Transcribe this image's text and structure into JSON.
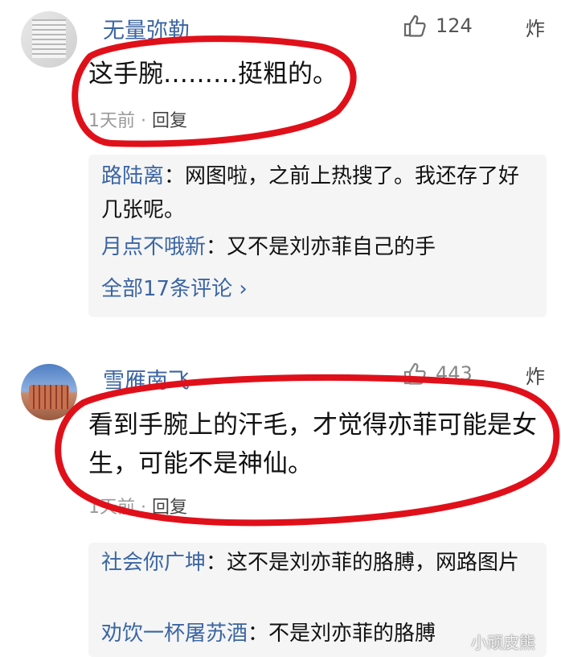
{
  "comments": [
    {
      "username": "无量弥勒",
      "likes": "124",
      "boom": "炸",
      "text": "这手腕………挺粗的。",
      "time": "1天前",
      "dot": "·",
      "reply": "回复",
      "replies": [
        {
          "user": "路陆离",
          "sep": "：",
          "text": "网图啦，之前上热搜了。我还存了好几张呢。"
        },
        {
          "user": "月点不哦新",
          "sep": "：",
          "text": "又不是刘亦菲自己的手"
        }
      ],
      "more": "全部17条评论 ›"
    },
    {
      "username": "雪雁南飞",
      "likes": "443",
      "boom": "炸",
      "text": "看到手腕上的汗毛，才觉得亦菲可能是女生，可能不是神仙。",
      "time": "1天前",
      "dot": "·",
      "reply": "回复",
      "replies": [
        {
          "user": "社会你广坤",
          "sep": "：",
          "text": "这不是刘亦菲的胳膊，网路图片"
        },
        {
          "user": "劝饮一杯屠苏酒",
          "sep": "：",
          "text": "不是刘亦菲的胳膊"
        }
      ]
    }
  ],
  "watermark": "小顽皮熊",
  "colors": {
    "username": "#3b65a3",
    "annotation": "#e0101a"
  }
}
